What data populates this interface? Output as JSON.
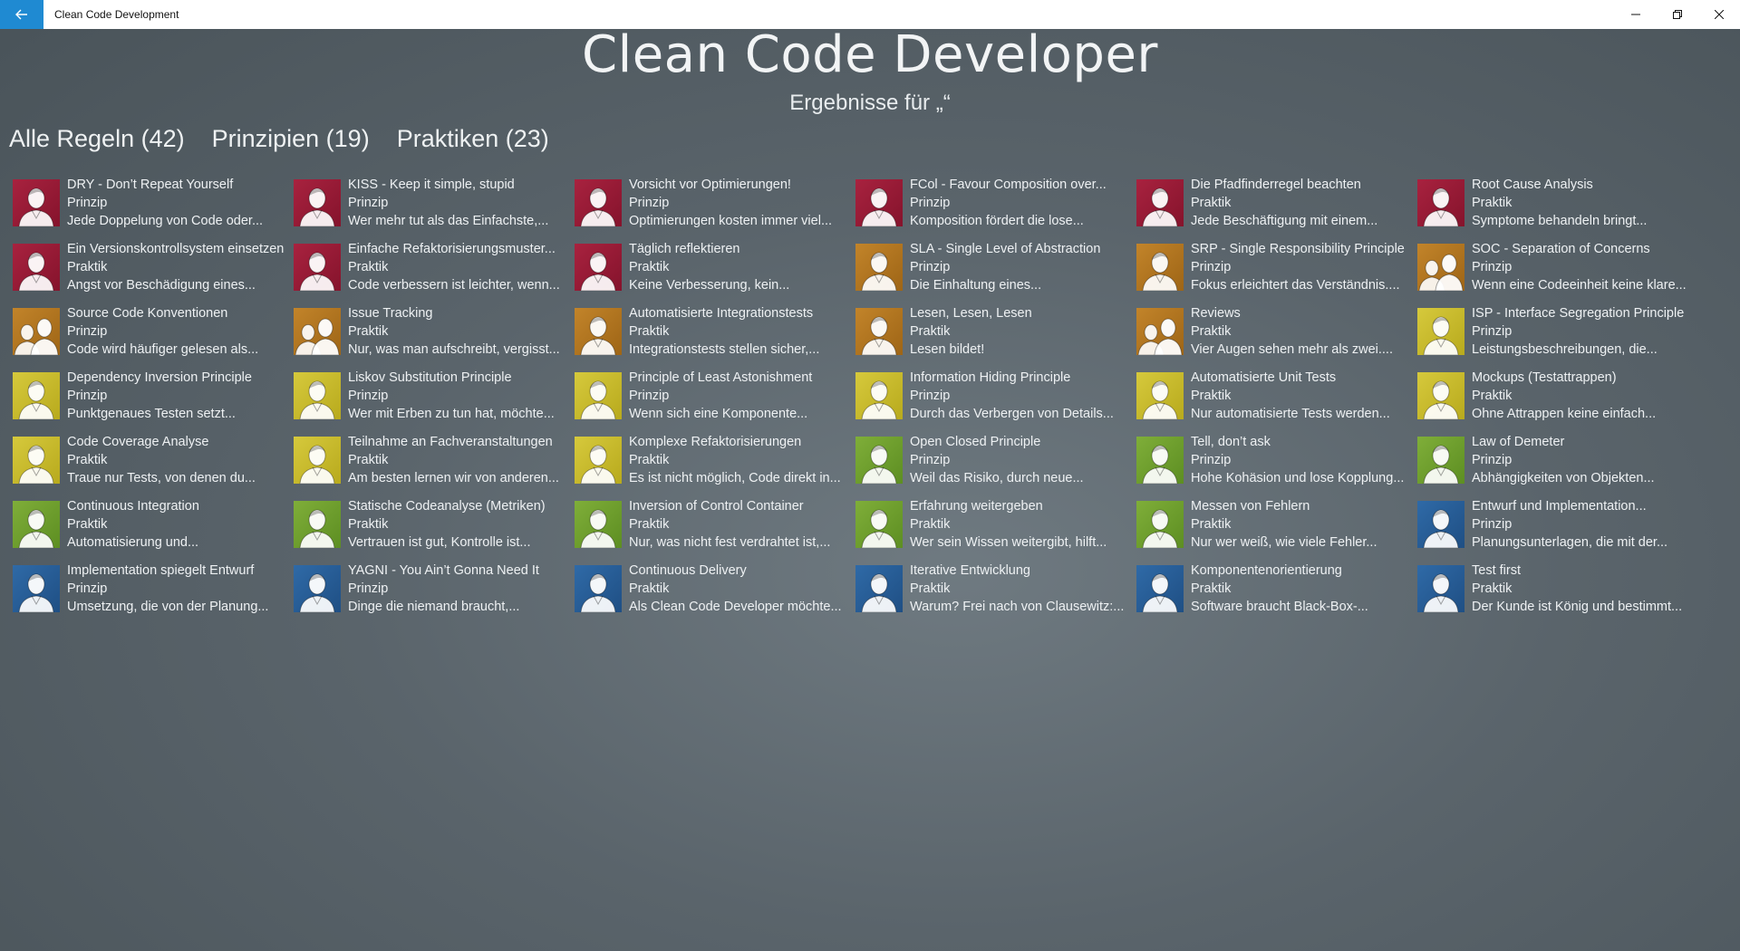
{
  "window": {
    "title": "Clean Code Development",
    "accent": "#1f8ad2"
  },
  "header": {
    "title": "Clean Code Developer",
    "subtitle": "Ergebnisse für „“"
  },
  "tabs": [
    {
      "label": "Alle Regeln (42)"
    },
    {
      "label": "Prinzipien (19)"
    },
    {
      "label": "Praktiken (23)"
    }
  ],
  "colors": {
    "red": "#a8223f",
    "orange": "#c2842a",
    "yellow": "#d6c93c",
    "green": "#7fae39",
    "blue": "#2f6aa7"
  },
  "rules": [
    {
      "title": "DRY - Don’t Repeat Yourself",
      "type": "Prinzip",
      "desc": "Jede Doppelung von Code oder...",
      "color": "red",
      "icon": "person-icon"
    },
    {
      "title": "KISS - Keep it simple, stupid",
      "type": "Prinzip",
      "desc": "Wer mehr tut als das Einfachste,...",
      "color": "red",
      "icon": "person-icon"
    },
    {
      "title": "Vorsicht vor Optimierungen!",
      "type": "Prinzip",
      "desc": "Optimierungen kosten immer viel...",
      "color": "red",
      "icon": "person-icon"
    },
    {
      "title": "FCol - Favour Composition over...",
      "type": "Prinzip",
      "desc": "Komposition fördert die lose...",
      "color": "red",
      "icon": "person-icon"
    },
    {
      "title": "Die Pfadfinderregel beachten",
      "type": "Praktik",
      "desc": "Jede Beschäftigung mit einem...",
      "color": "red",
      "icon": "person-icon"
    },
    {
      "title": "Root Cause Analysis",
      "type": "Praktik",
      "desc": "Symptome behandeln bringt...",
      "color": "red",
      "icon": "person-icon"
    },
    {
      "title": "Ein Versionskontrollsystem einsetzen",
      "type": "Praktik",
      "desc": "Angst vor Beschädigung eines...",
      "color": "red",
      "icon": "person-icon"
    },
    {
      "title": "Einfache Refaktorisierungsmuster...",
      "type": "Praktik",
      "desc": "Code verbessern ist leichter, wenn...",
      "color": "red",
      "icon": "person-icon"
    },
    {
      "title": "Täglich reflektieren",
      "type": "Praktik",
      "desc": "Keine Verbesserung, kein...",
      "color": "red",
      "icon": "person-icon"
    },
    {
      "title": "SLA - Single Level of Abstraction",
      "type": "Prinzip",
      "desc": "Die Einhaltung eines...",
      "color": "orange",
      "icon": "person-icon"
    },
    {
      "title": "SRP - Single Responsibility Principle",
      "type": "Prinzip",
      "desc": "Fokus erleichtert das Verständnis....",
      "color": "orange",
      "icon": "person-icon"
    },
    {
      "title": "SOC - Separation of Concerns",
      "type": "Prinzip",
      "desc": "Wenn eine Codeeinheit keine klare...",
      "color": "orange",
      "icon": "two-persons-icon"
    },
    {
      "title": "Source Code Konventionen",
      "type": "Prinzip",
      "desc": "Code wird häufiger gelesen als...",
      "color": "orange",
      "icon": "two-persons-icon"
    },
    {
      "title": "Issue Tracking",
      "type": "Praktik",
      "desc": "Nur, was man aufschreibt, vergisst...",
      "color": "orange",
      "icon": "two-persons-icon"
    },
    {
      "title": "Automatisierte Integrationstests",
      "type": "Praktik",
      "desc": "Integrationstests stellen sicher,...",
      "color": "orange",
      "icon": "person-icon"
    },
    {
      "title": "Lesen, Lesen, Lesen",
      "type": "Praktik",
      "desc": "Lesen bildet!",
      "color": "orange",
      "icon": "person-icon"
    },
    {
      "title": "Reviews",
      "type": "Praktik",
      "desc": "Vier Augen sehen mehr als zwei....",
      "color": "orange",
      "icon": "two-persons-icon"
    },
    {
      "title": "ISP - Interface Segregation Principle",
      "type": "Prinzip",
      "desc": "Leistungsbeschreibungen, die...",
      "color": "yellow",
      "icon": "person-icon"
    },
    {
      "title": "Dependency Inversion Principle",
      "type": "Prinzip",
      "desc": "Punktgenaues Testen setzt...",
      "color": "yellow",
      "icon": "person-icon"
    },
    {
      "title": "Liskov Substitution Principle",
      "type": "Prinzip",
      "desc": "Wer mit Erben zu tun hat, möchte...",
      "color": "yellow",
      "icon": "person-icon"
    },
    {
      "title": "Principle of Least Astonishment",
      "type": "Prinzip",
      "desc": "Wenn sich eine Komponente...",
      "color": "yellow",
      "icon": "person-icon"
    },
    {
      "title": "Information Hiding Principle",
      "type": "Prinzip",
      "desc": "Durch das Verbergen von Details...",
      "color": "yellow",
      "icon": "person-icon"
    },
    {
      "title": "Automatisierte Unit Tests",
      "type": "Praktik",
      "desc": "Nur automatisierte Tests werden...",
      "color": "yellow",
      "icon": "person-icon"
    },
    {
      "title": "Mockups (Testattrappen)",
      "type": "Praktik",
      "desc": "Ohne Attrappen keine einfach...",
      "color": "yellow",
      "icon": "person-icon"
    },
    {
      "title": "Code Coverage Analyse",
      "type": "Praktik",
      "desc": "Traue nur Tests, von denen du...",
      "color": "yellow",
      "icon": "person-icon"
    },
    {
      "title": "Teilnahme an Fachveranstaltungen",
      "type": "Praktik",
      "desc": "Am besten lernen wir von anderen...",
      "color": "yellow",
      "icon": "person-icon"
    },
    {
      "title": "Komplexe Refaktorisierungen",
      "type": "Praktik",
      "desc": "Es ist nicht möglich, Code direkt in...",
      "color": "yellow",
      "icon": "person-icon"
    },
    {
      "title": "Open Closed Principle",
      "type": "Prinzip",
      "desc": "Weil das Risiko, durch neue...",
      "color": "green",
      "icon": "person-icon"
    },
    {
      "title": "Tell, don’t ask",
      "type": "Prinzip",
      "desc": "Hohe Kohäsion und lose Kopplung...",
      "color": "green",
      "icon": "person-icon"
    },
    {
      "title": "Law of Demeter",
      "type": "Prinzip",
      "desc": "Abhängigkeiten von Objekten...",
      "color": "green",
      "icon": "person-icon"
    },
    {
      "title": "Continuous Integration",
      "type": "Praktik",
      "desc": "Automatisierung und...",
      "color": "green",
      "icon": "person-icon"
    },
    {
      "title": "Statische Codeanalyse (Metriken)",
      "type": "Praktik",
      "desc": "Vertrauen ist gut, Kontrolle ist...",
      "color": "green",
      "icon": "person-icon"
    },
    {
      "title": "Inversion of Control Container",
      "type": "Praktik",
      "desc": "Nur, was nicht fest verdrahtet ist,...",
      "color": "green",
      "icon": "person-icon"
    },
    {
      "title": "Erfahrung weitergeben",
      "type": "Praktik",
      "desc": "Wer sein Wissen weitergibt, hilft...",
      "color": "green",
      "icon": "person-icon"
    },
    {
      "title": "Messen von Fehlern",
      "type": "Praktik",
      "desc": "Nur wer weiß, wie viele Fehler...",
      "color": "green",
      "icon": "person-icon"
    },
    {
      "title": "Entwurf und Implementation...",
      "type": "Prinzip",
      "desc": "Planungsunterlagen, die mit der...",
      "color": "blue",
      "icon": "person-icon"
    },
    {
      "title": "Implementation spiegelt Entwurf",
      "type": "Prinzip",
      "desc": "Umsetzung, die von der Planung...",
      "color": "blue",
      "icon": "person-icon"
    },
    {
      "title": "YAGNI - You Ain’t Gonna Need It",
      "type": "Prinzip",
      "desc": "Dinge die niemand braucht,...",
      "color": "blue",
      "icon": "person-icon"
    },
    {
      "title": "Continuous Delivery",
      "type": "Praktik",
      "desc": "Als Clean Code Developer möchte...",
      "color": "blue",
      "icon": "person-icon"
    },
    {
      "title": "Iterative Entwicklung",
      "type": "Praktik",
      "desc": "Warum? Frei nach von Clausewitz:...",
      "color": "blue",
      "icon": "person-icon"
    },
    {
      "title": "Komponentenorientierung",
      "type": "Praktik",
      "desc": "Software braucht Black-Box-...",
      "color": "blue",
      "icon": "person-icon"
    },
    {
      "title": "Test first",
      "type": "Praktik",
      "desc": "Der Kunde ist König und bestimmt...",
      "color": "blue",
      "icon": "person-icon"
    }
  ]
}
